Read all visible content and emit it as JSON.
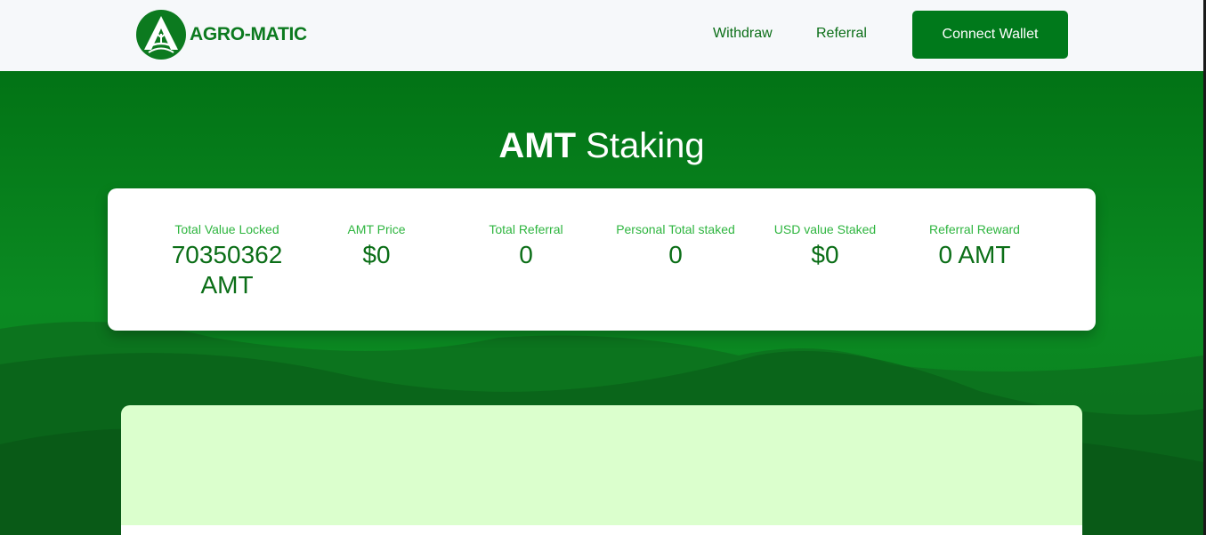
{
  "brand": {
    "name": "AGRO-MATIC"
  },
  "nav": {
    "withdraw": "Withdraw",
    "referral": "Referral",
    "connect_wallet": "Connect Wallet"
  },
  "hero": {
    "title_bold": "AMT",
    "title_rest": "Staking"
  },
  "stats": [
    {
      "label": "Total Value Locked",
      "value": "70350362 AMT"
    },
    {
      "label": "AMT Price",
      "value": "$0"
    },
    {
      "label": "Total Referral",
      "value": "0"
    },
    {
      "label": "Personal Total staked",
      "value": "0"
    },
    {
      "label": "USD value Staked",
      "value": "$0"
    },
    {
      "label": "Referral Reward",
      "value": "0 AMT"
    }
  ],
  "colors": {
    "brand_green": "#00791b",
    "stat_label": "#2eb53f",
    "stat_value": "#0b6e17",
    "panel_bg": "#dbffcd"
  }
}
